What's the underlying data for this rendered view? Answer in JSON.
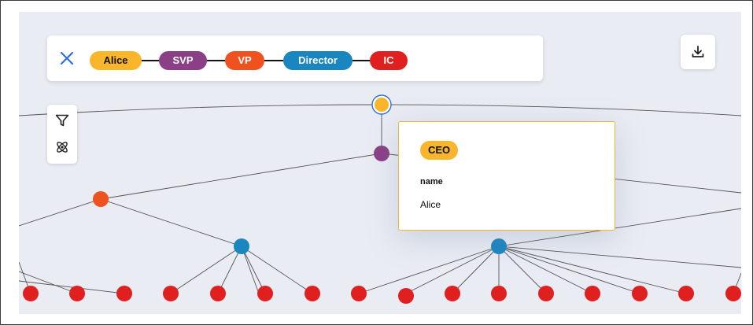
{
  "path": {
    "close_icon": "close-icon",
    "chips": [
      {
        "label": "Alice",
        "color": "#f9b52c",
        "text_color": "#111111"
      },
      {
        "label": "SVP",
        "color": "#8b3f86",
        "text_color": "#ffffff"
      },
      {
        "label": "VP",
        "color": "#f0521f",
        "text_color": "#ffffff"
      },
      {
        "label": "Director",
        "color": "#1a86c0",
        "text_color": "#ffffff"
      },
      {
        "label": "IC",
        "color": "#e01f1f",
        "text_color": "#ffffff"
      }
    ]
  },
  "toolbar": {
    "download_icon": "download-icon",
    "filter_icon": "filter-icon",
    "atom_icon": "atom-icon"
  },
  "tooltip": {
    "badge": "CEO",
    "badge_color": "#f9b52c",
    "key": "name",
    "value": "Alice"
  },
  "graph": {
    "level_colors": {
      "ceo": "#f9b52c",
      "svp": "#8b3f86",
      "vp": "#f0521f",
      "director": "#1a86c0",
      "ic": "#e01f1f"
    },
    "edge_color": "#555555"
  }
}
